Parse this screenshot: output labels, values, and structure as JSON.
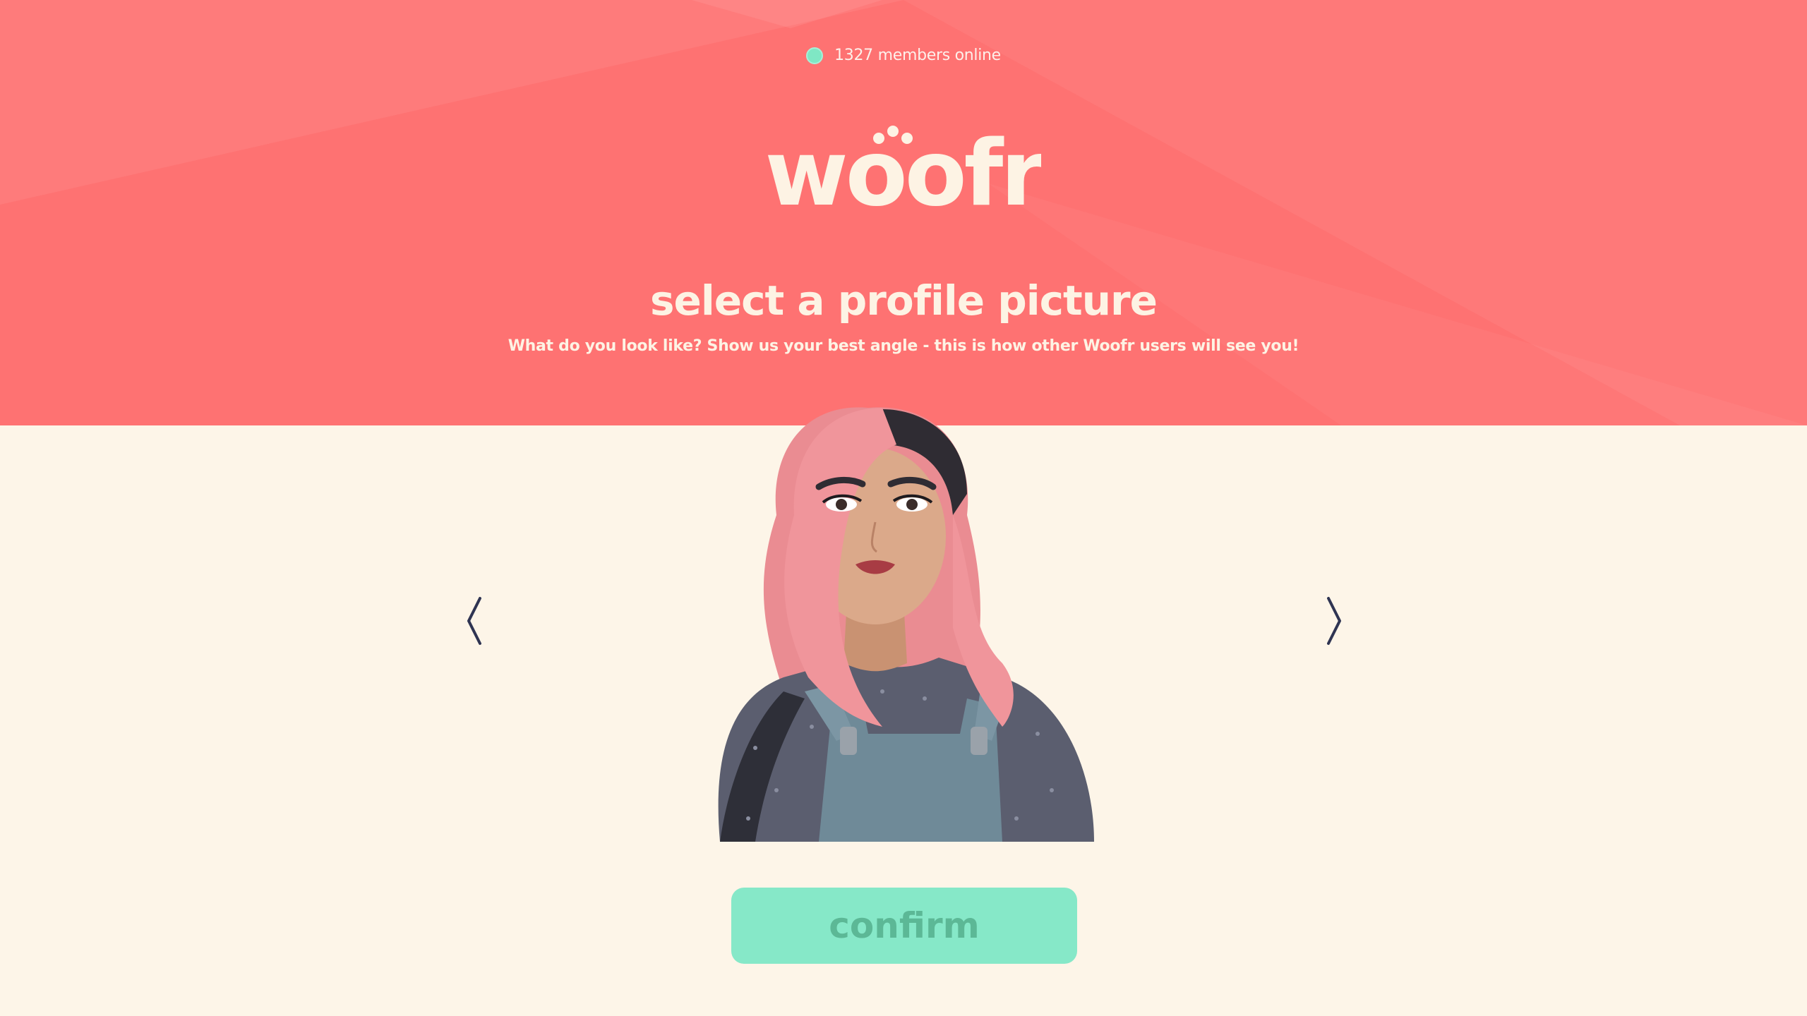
{
  "status": {
    "online_text": "1327 members online",
    "dot_color": "#7fe7c4"
  },
  "brand": {
    "logo_text": "woofr",
    "header_color": "#fe7272",
    "page_background": "#fdf5e8"
  },
  "main": {
    "title": "select a profile picture",
    "subtitle": "What do you look like? Show us your best angle - this is how other Woofr users will see you!"
  },
  "carousel": {
    "prev_icon": "chevron-left-icon",
    "next_icon": "chevron-right-icon",
    "avatar_alt": "profile-avatar"
  },
  "actions": {
    "confirm_label": "confirm",
    "confirm_color": "#86e8c8"
  }
}
